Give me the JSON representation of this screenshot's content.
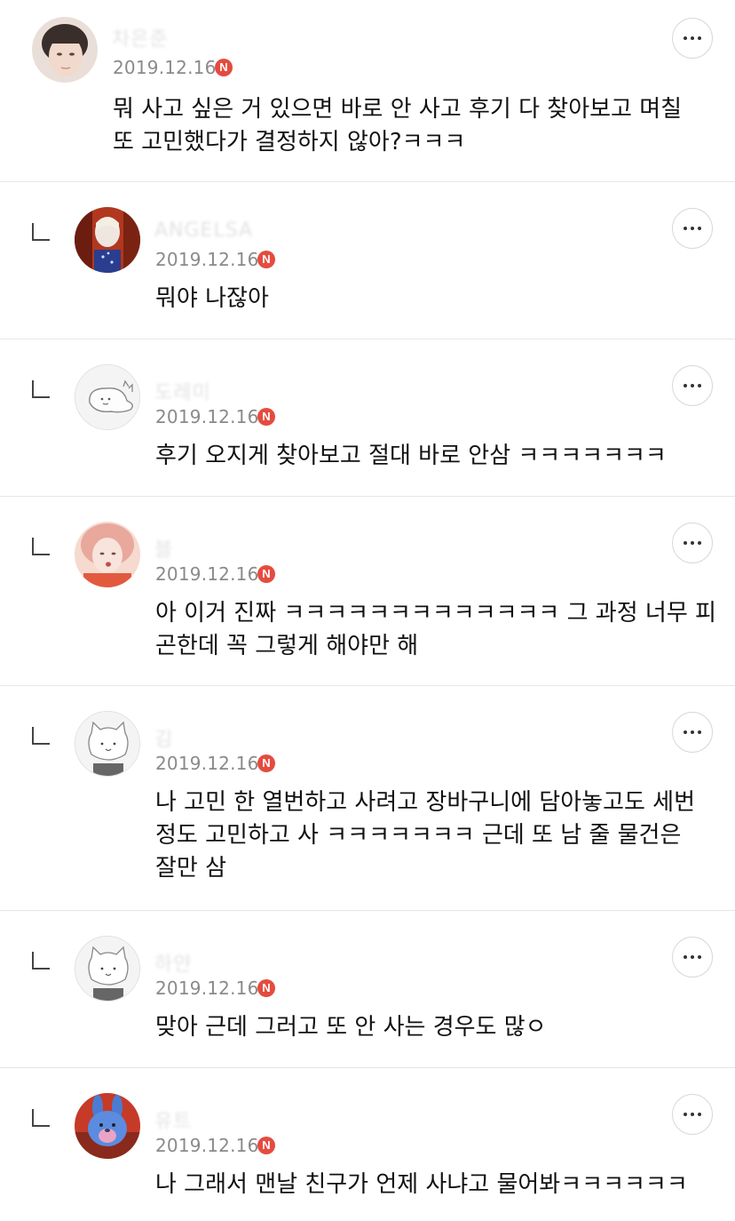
{
  "comments": [
    {
      "author": "차은준",
      "date": "2019.12.16",
      "badge": "N",
      "text": "뭐 사고 싶은 거 있으면 바로 안 사고 후기 다 찾아보고 며칠\n또 고민했다가 결정하지 않아?ㅋㅋㅋ",
      "reply": false,
      "avatar": "portrait-photo"
    },
    {
      "author": "ANGELSA",
      "date": "2019.12.16",
      "badge": "N",
      "text": "뭐야 나잖아",
      "reply": true,
      "avatar": "princess-character"
    },
    {
      "author": "도레미",
      "date": "2019.12.16",
      "badge": "N",
      "text": "후기 오지게 찾아보고 절대 바로 안삼 ㅋㅋㅋㅋㅋㅋㅋ",
      "reply": true,
      "avatar": "sketch-creature"
    },
    {
      "author": "블",
      "date": "2019.12.16",
      "badge": "N",
      "text": "아 이거 진짜 ㅋㅋㅋㅋㅋㅋㅋㅋㅋㅋㅋㅋㅋ 그 과정 너무 피\n곤한데 꼭 그렇게 해야만 해",
      "reply": true,
      "avatar": "selfie-photo"
    },
    {
      "author": "김",
      "date": "2019.12.16",
      "badge": "N",
      "text": "나 고민 한 열번하고 사려고 장바구니에 담아놓고도 세번\n정도 고민하고 사 ㅋㅋㅋㅋㅋㅋㅋ 근데 또 남 줄 물건은\n잘만 삼",
      "reply": true,
      "avatar": "default-cat"
    },
    {
      "author": "하얀",
      "date": "2019.12.16",
      "badge": "N",
      "text": "맞아 근데 그러고 또 안 사는 경우도 많ㅇ",
      "reply": true,
      "avatar": "default-cat"
    },
    {
      "author": "유트",
      "date": "2019.12.16",
      "badge": "N",
      "text": "나 그래서 맨날 친구가 언제 사냐고 물어봐ㅋㅋㅋㅋㅋㅋ",
      "reply": true,
      "avatar": "blue-bear"
    }
  ]
}
